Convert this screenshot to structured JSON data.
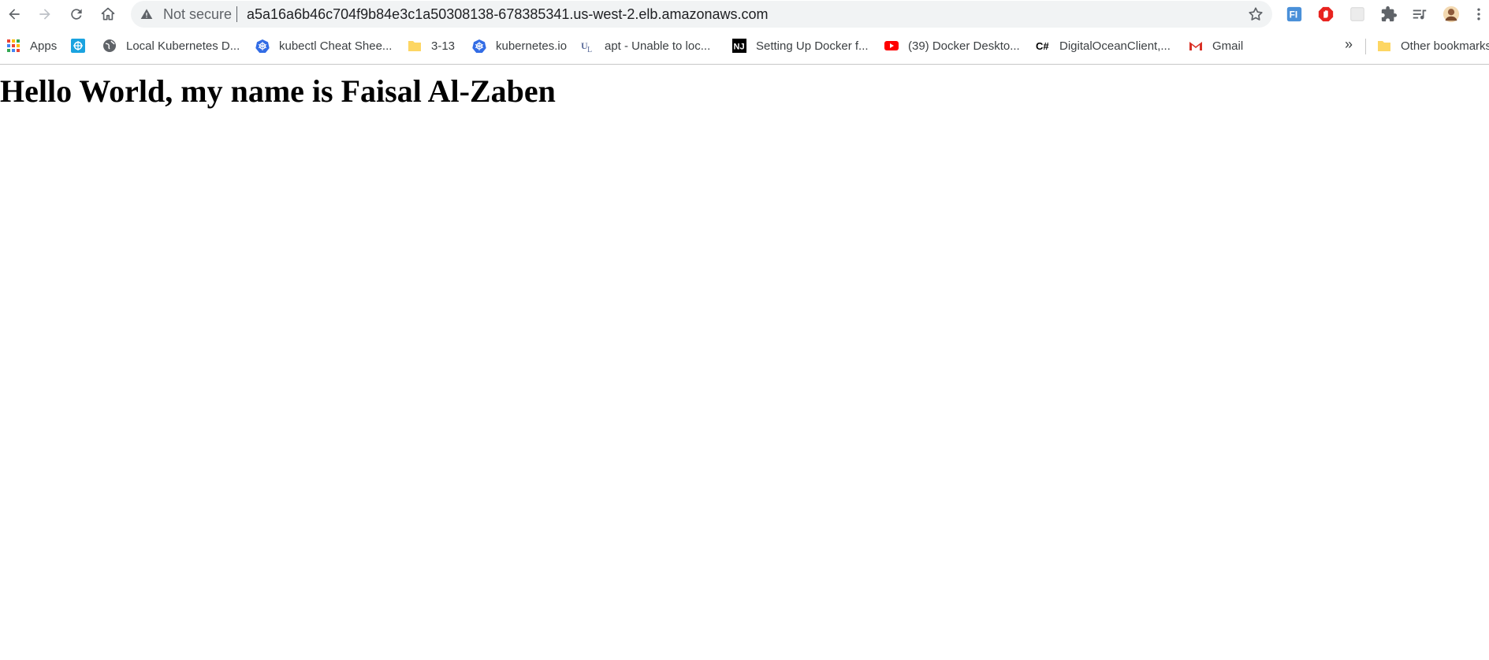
{
  "browser": {
    "security_label": "Not secure",
    "url": "a5a16a6b46c704f9b84e3c1a50308138-678385341.us-west-2.elb.amazonaws.com",
    "extensions": [
      "fi-extension-icon",
      "adblock-icon",
      "blank-extension-icon",
      "puzzle-icon",
      "media-icon"
    ]
  },
  "bookmarks": {
    "items": [
      {
        "label": "Apps",
        "icon": "apps-grid-icon"
      },
      {
        "label": "Local Kubernetes D...",
        "icon": "kubernetes-d-icon"
      },
      {
        "label": "kubectl Cheat Shee...",
        "icon": "globe-icon"
      },
      {
        "label": "3-13",
        "icon": "folder-icon"
      },
      {
        "label": "kubernetes.io",
        "icon": "kubernetes-icon"
      },
      {
        "label": "apt - Unable to loc...",
        "icon": "ul-icon"
      },
      {
        "label": "Setting Up Docker f...",
        "icon": "nj-icon"
      },
      {
        "label": "(39) Docker Deskto...",
        "icon": "youtube-icon"
      },
      {
        "label": "DigitalOceanClient,...",
        "icon": "csharp-icon"
      },
      {
        "label": "Gmail",
        "icon": "gmail-icon"
      }
    ],
    "overflow": "»",
    "other_label": "Other bookmarks"
  },
  "page": {
    "heading": "Hello World, my name is Faisal Al-Zaben"
  },
  "colors": {
    "toolbar_bg": "#ffffff",
    "omnibox_bg": "#f1f3f4",
    "icon_gray": "#5f6368",
    "folder_yellow": "#fdd663",
    "kube_blue": "#326ce5",
    "youtube_red": "#ff0000"
  }
}
